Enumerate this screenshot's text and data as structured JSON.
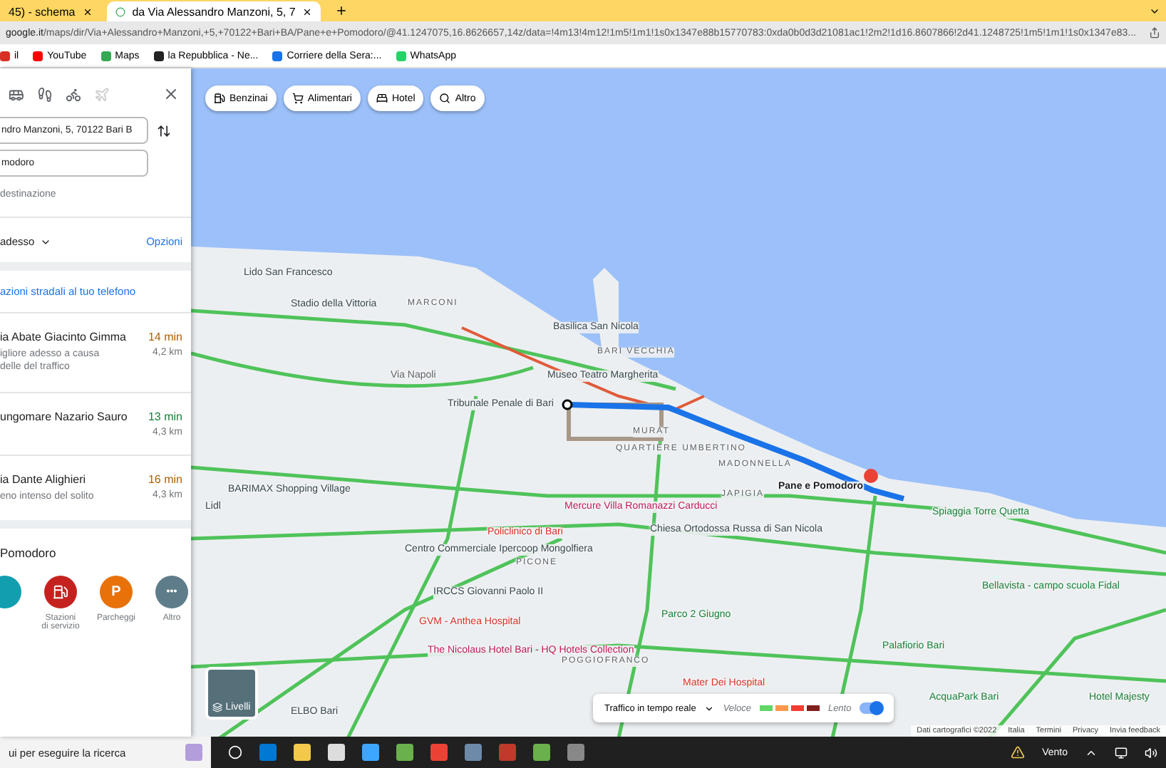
{
  "browser": {
    "tabs": [
      {
        "title": "45) - schema",
        "selected": false
      },
      {
        "title": "da Via Alessandro Manzoni, 5, 7",
        "selected": true
      }
    ],
    "url_host": "google.it",
    "url_path": "/maps/dir/Via+Alessandro+Manzoni,+5,+70122+Bari+BA/Pane+e+Pomodoro/@41.1247075,16.8626657,14z/data=!4m13!4m12!1m5!1m1!1s0x1347e88b15770783:0xda0b0d3d21081ac1!2m2!1d16.8607866!2d41.1248725!1m5!1m1!1s0x1347e83...",
    "bookmarks": [
      {
        "label": "il",
        "kind": "mail"
      },
      {
        "label": "YouTube",
        "kind": "youtube"
      },
      {
        "label": "Maps",
        "kind": "maps"
      },
      {
        "label": "la Repubblica - Ne...",
        "kind": "repubblica"
      },
      {
        "label": "Corriere della Sera:...",
        "kind": "corriere"
      },
      {
        "label": "WhatsApp",
        "kind": "whatsapp"
      }
    ]
  },
  "directions": {
    "origin": "ndro Manzoni, 5, 70122 Bari B",
    "destination": "modoro",
    "add_stop": "destinazione",
    "depart": "adesso",
    "options": "Opzioni",
    "send_link": "azioni stradali al tuo telefono",
    "routes": [
      {
        "name": "ia Abate Giacinto Gimma",
        "time": "14 min",
        "color": "#b06000",
        "note": "igliore adesso a causa delle del traffico",
        "distance": "4,2 km"
      },
      {
        "name": "ungomare Nazario Sauro",
        "time": "13 min",
        "color": "#188038",
        "distance": "4,3 km"
      },
      {
        "name": "ia Dante Alighieri",
        "time": "16 min",
        "color": "#b06000",
        "note": "eno intenso del solito",
        "distance": "4,3 km"
      }
    ],
    "nearby_title": "Pomodoro",
    "nearby": [
      {
        "kind": "teal"
      },
      {
        "label": "Stazioni di servizio",
        "kind": "fuel"
      },
      {
        "label": "Parcheggi",
        "kind": "parking",
        "glyph": "P"
      },
      {
        "label": "Altro",
        "kind": "more",
        "glyph": "•••"
      }
    ]
  },
  "map": {
    "chips": [
      {
        "label": "Benzinai",
        "kind": "fuel"
      },
      {
        "label": "Alimentari",
        "kind": "cart"
      },
      {
        "label": "Hotel",
        "kind": "bed"
      },
      {
        "label": "Altro",
        "kind": "search"
      }
    ],
    "labels": [
      {
        "text": "Lido San Francesco",
        "kind": "poi"
      },
      {
        "text": "Stadio della Vittoria",
        "kind": "poi"
      },
      {
        "text": "MARCONI",
        "kind": "district"
      },
      {
        "text": "Basilica San Nicola",
        "kind": "poi"
      },
      {
        "text": "BARI VECCHIA",
        "kind": "district"
      },
      {
        "text": "Via Napoli",
        "kind": "road"
      },
      {
        "text": "Museo Teatro Margherita",
        "kind": "poi"
      },
      {
        "text": "Tribunale Penale di Bari",
        "kind": "poi"
      },
      {
        "text": "MURAT",
        "kind": "district"
      },
      {
        "text": "QUARTIERE UMBERTINO",
        "kind": "district"
      },
      {
        "text": "MADONNELLA",
        "kind": "district"
      },
      {
        "text": "Pane e Pomodoro",
        "kind": "dest"
      },
      {
        "text": "JAPIGIA",
        "kind": "district"
      },
      {
        "text": "Mercure Villa Romanazzi Carducci",
        "kind": "hotel"
      },
      {
        "text": "Policlinico di Bari",
        "kind": "hospital"
      },
      {
        "text": "Chiesa Ortodossa Russa di San Nicola",
        "kind": "poi"
      },
      {
        "text": "Centro Commerciale Ipercoop Mongolfiera",
        "kind": "poi"
      },
      {
        "text": "PICONE",
        "kind": "district"
      },
      {
        "text": "IRCCS Giovanni Paolo II",
        "kind": "poi"
      },
      {
        "text": "GVM - Anthea Hospital",
        "kind": "hospital"
      },
      {
        "text": "The Nicolaus Hotel Bari - HQ Hotels Collection",
        "kind": "hotel"
      },
      {
        "text": "POGGIOFRANCO",
        "kind": "district"
      },
      {
        "text": "Parco 2 Giugno",
        "kind": "park"
      },
      {
        "text": "Mater Dei Hospital",
        "kind": "hospital"
      },
      {
        "text": "Spiaggia Torre Quetta",
        "kind": "park"
      },
      {
        "text": "Bellavista - campo scuola Fidal",
        "kind": "park"
      },
      {
        "text": "Palafiorio Bari",
        "kind": "park"
      },
      {
        "text": "AcquaPark Bari",
        "kind": "park"
      },
      {
        "text": "Hotel Majesty",
        "kind": "park"
      },
      {
        "text": "BARIMAX Shopping Village",
        "kind": "poi"
      },
      {
        "text": "ELBO Bari",
        "kind": "poi"
      },
      {
        "text": "Lidl",
        "kind": "poi"
      }
    ],
    "layers": "Livelli",
    "traffic": {
      "label": "Traffico in tempo reale",
      "fast": "Veloce",
      "slow": "Lento",
      "on": true
    },
    "footer": [
      "Dati cartografici ©2022",
      "Italia",
      "Termini",
      "Privacy",
      "Invia feedback"
    ]
  },
  "taskbar": {
    "search": "ui per eseguire la ricerca",
    "weather": "Vento"
  }
}
